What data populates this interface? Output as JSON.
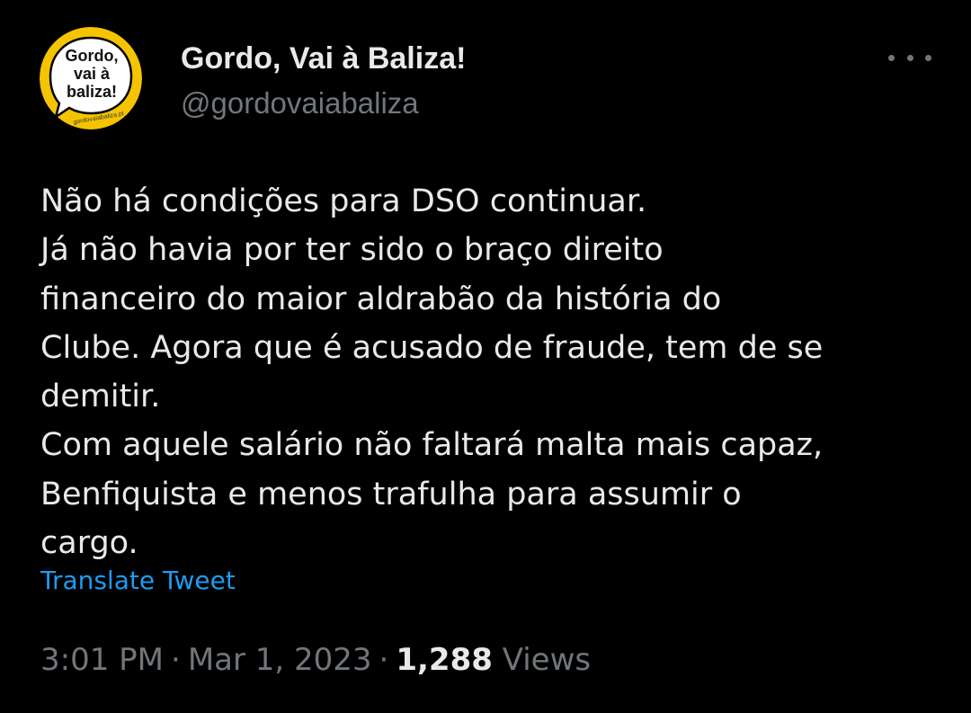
{
  "account": {
    "display_name": "Gordo, Vai à Baliza!",
    "handle": "@gordovaiabaliza",
    "avatar": {
      "line1": "Gordo,",
      "line2": "vai à",
      "line3": "baliza!",
      "site": "gordovaiabaliza.pt",
      "bubble_color": "#ffffff",
      "ring_color": "#f5c400"
    }
  },
  "menu": {
    "icon": "more-horizontal-icon"
  },
  "tweet": {
    "lines": [
      "Não há condições para DSO continuar.",
      "Já não havia por ter sido o braço direito",
      "financeiro do maior aldrabão da história do",
      "Clube. Agora que é acusado de fraude, tem de se",
      "demitir.",
      "Com aquele salário não faltará malta mais capaz,",
      "Benfiquista e menos trafulha para assumir o",
      "cargo."
    ],
    "translate_label": "Translate Tweet"
  },
  "meta": {
    "time": "3:01 PM",
    "separator": "·",
    "date": "Mar 1, 2023",
    "views_count": "1,288",
    "views_label": "Views"
  },
  "colors": {
    "background": "#000000",
    "text_primary": "#e7e9ea",
    "text_secondary": "#71767b",
    "link": "#1d9bf0"
  }
}
